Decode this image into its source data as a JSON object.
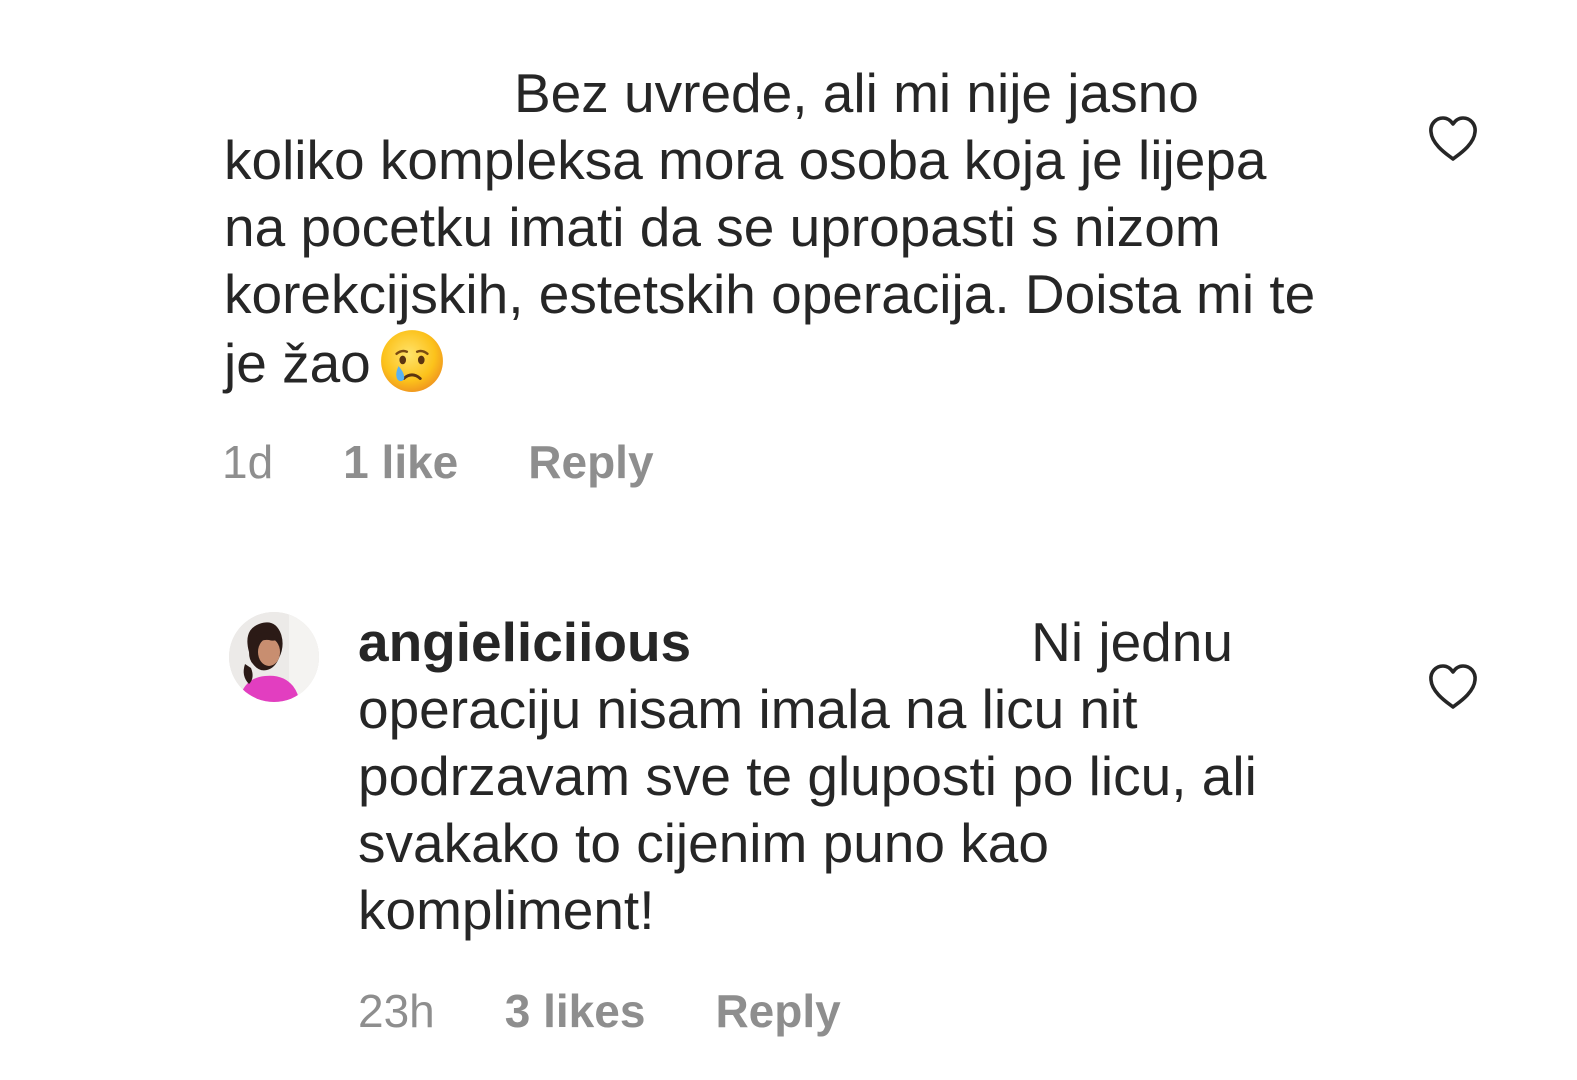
{
  "comments": [
    {
      "username": "",
      "text_first_line": "Bez uvrede, ali mi nije jasno",
      "text_rest": "koliko kompleksa mora osoba koja je lijepa na pocetku imati da se upropasti s nizom korekcijskih, estetskih operacija. Doista mi te je žao",
      "emoji": "crying-face",
      "time": "1d",
      "likes": "1 like",
      "reply": "Reply"
    },
    {
      "username": "angieliciious",
      "text_first_line": "Ni jednu",
      "text_rest": "operaciju nisam imala na licu nit podrzavam sve te gluposti po licu, ali svakako to cijenim puno kao kompliment!",
      "time": "23h",
      "likes": "3 likes",
      "reply": "Reply"
    }
  ],
  "icons": {
    "like": "heart-outline-icon"
  },
  "colors": {
    "text": "#262626",
    "meta": "#8e8e8e",
    "background": "#ffffff"
  }
}
